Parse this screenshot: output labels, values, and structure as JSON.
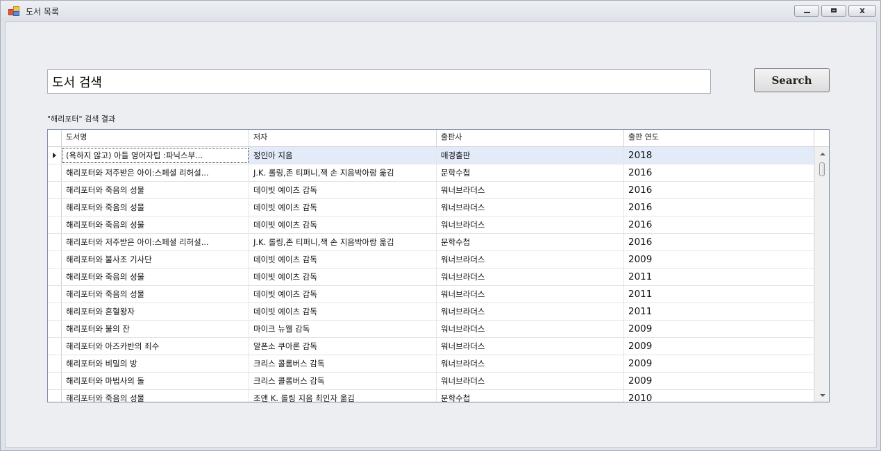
{
  "window": {
    "title": "도서 목록",
    "close_glyph": "x"
  },
  "search": {
    "value": "도서 검색",
    "button_label": "Search"
  },
  "result_label": "\"해리포터\" 검색 결과",
  "grid": {
    "columns": [
      "도서명",
      "저자",
      "출판사",
      "출판 연도"
    ],
    "selected_row": 0,
    "rows": [
      [
        "(욕하지 않고) 아들 영어자립 :파닉스부...",
        "정인아 지음",
        "매경출판",
        "2018"
      ],
      [
        "해리포터와 저주받은 아이:스페셜 리허설...",
        "J.K. 롤링,존 티퍼니,잭 손 지음박아람 옮김",
        "문학수첩",
        "2016"
      ],
      [
        "해리포터와 죽음의 성물",
        "데이빗 예이츠 감독",
        "워너브라더스",
        "2016"
      ],
      [
        "해리포터와 죽음의 성물",
        "데이빗 예이츠 감독",
        "워너브라더스",
        "2016"
      ],
      [
        "해리포터와 죽음의 성물",
        "데이빗 예이츠 감독",
        "워너브라더스",
        "2016"
      ],
      [
        "해리포터와 저주받은 아이:스페셜 리허설...",
        "J.K. 롤링,존 티퍼니,잭 손 지음박아람 옮김",
        "문학수첩",
        "2016"
      ],
      [
        "해리포터와 불사조 기사단",
        "데이빗 예이츠 감독",
        "워너브라더스",
        "2009"
      ],
      [
        "해리포터와 죽음의 성물",
        "데이빗 예이츠 감독",
        "워너브라더스",
        "2011"
      ],
      [
        "해리포터와 죽음의 성물",
        "데이빗 예이츠 감독",
        "워너브라더스",
        "2011"
      ],
      [
        "해리포터와 혼혈왕자",
        "데이빗 예이츠 감독",
        "워너브라더스",
        "2011"
      ],
      [
        "해리포터와 불의 잔",
        "마이크 뉴웰 감독",
        "워너브라더스",
        "2009"
      ],
      [
        "해리포터와 아즈카반의 죄수",
        "알폰소 쿠아론 감독",
        "워너브라더스",
        "2009"
      ],
      [
        "해리포터와 비밀의 방",
        "크리스 콜롬버스 감독",
        "워너브라더스",
        "2009"
      ],
      [
        "해리포터와 마법사의 돌",
        "크리스 콜롬버스 감독",
        "워너브라더스",
        "2009"
      ],
      [
        "해리포터와 죽음의 성물",
        "조앤 K. 롤링 지음 최인자 옮김",
        "문학수첩",
        "2010"
      ]
    ]
  }
}
